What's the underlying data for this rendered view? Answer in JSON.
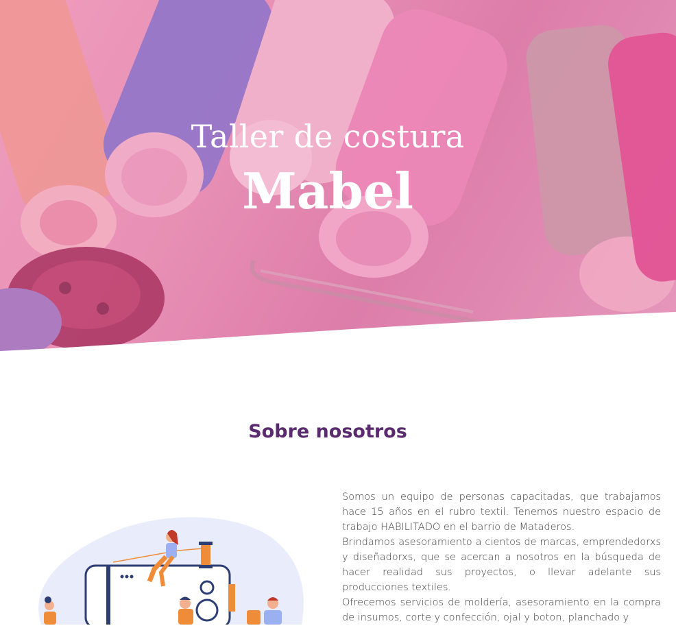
{
  "hero": {
    "title": "Taller de costura",
    "name": "Mabel"
  },
  "about": {
    "heading": "Sobre nosotros",
    "paragraphs": [
      "Somos un equipo de personas capacitadas, que trabajamos hace 15 años en el rubro textil. Tenemos nuestro espacio de trabajo HABILITADO en el barrio de Mataderos.",
      "Brindamos asesoramiento a cientos de marcas, emprendedorxs y diseñadorxs, que se acercan a nosotros en la búsqueda de hacer realidad sus proyectos, o llevar adelante sus producciones textiles.",
      "Ofrecemos servicios de moldería, asesoramiento en la compra de insumos, corte y confección, ojal y boton, planchado y"
    ]
  },
  "colors": {
    "heading": "#5b2b6f",
    "hero_overlay": "#e88fb5"
  }
}
